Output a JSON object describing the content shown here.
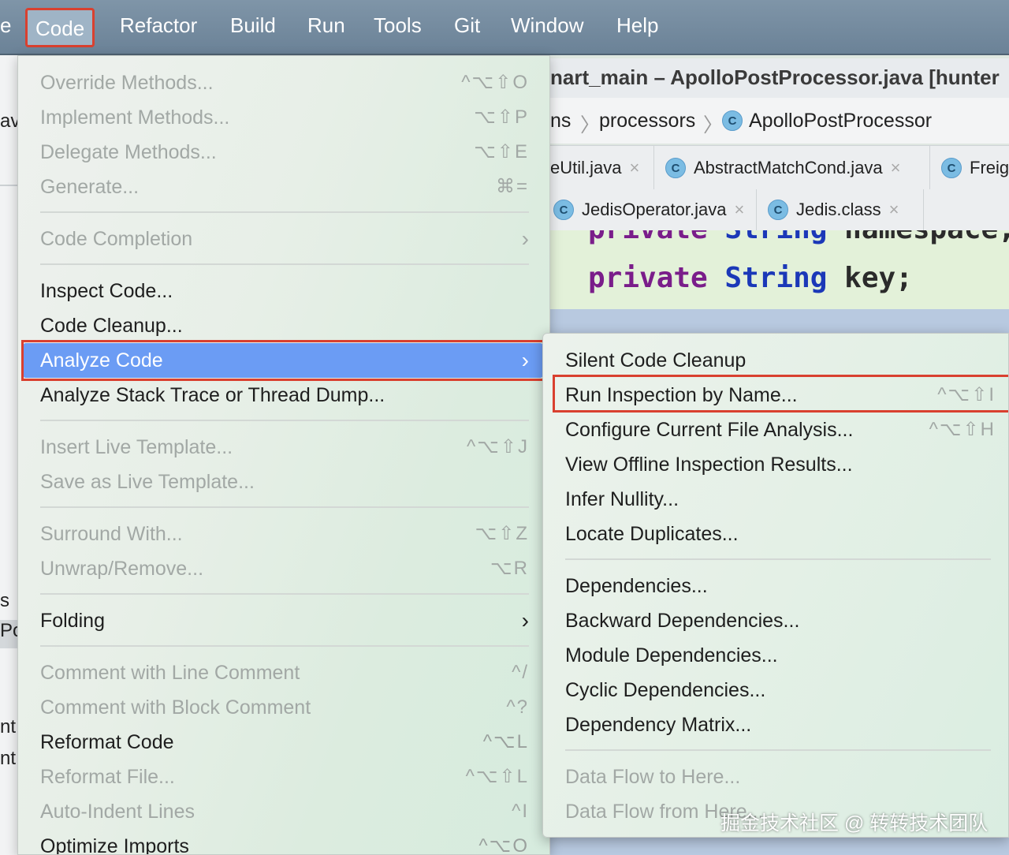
{
  "menubar": {
    "items": [
      "e",
      "Code",
      "Refactor",
      "Build",
      "Run",
      "Tools",
      "Git",
      "Window",
      "Help"
    ]
  },
  "ide": {
    "title": "nart_main – ApolloPostProcessor.java [hunter",
    "breadcrumb": [
      "ns",
      "processors",
      "ApolloPostProcessor"
    ],
    "class_badge": "C",
    "tabs_row1": [
      "eUtil.java",
      "AbstractMatchCond.java",
      "Freig"
    ],
    "tabs_row2": [
      "JedisOperator.java",
      "Jedis.class"
    ],
    "close_glyph": "×",
    "code": {
      "line1": {
        "kw": "private",
        "ty": "String",
        "id": "namespace;"
      },
      "line2": {
        "kw": "private",
        "ty": "String",
        "id": "key;"
      }
    },
    "left_strip": [
      "av",
      "s",
      "Po",
      "nt",
      "nt"
    ]
  },
  "code_menu": {
    "items": [
      {
        "label": "Override Methods...",
        "shortcut": "^⌥⇧O",
        "disabled": true
      },
      {
        "label": "Implement Methods...",
        "shortcut": "⌥⇧P",
        "disabled": true
      },
      {
        "label": "Delegate Methods...",
        "shortcut": "⌥⇧E",
        "disabled": true
      },
      {
        "label": "Generate...",
        "shortcut": "⌘=",
        "disabled": true
      },
      {
        "label": "Code Completion",
        "shortcut": "›",
        "disabled": true
      },
      {
        "label": "Inspect Code...",
        "shortcut": "",
        "disabled": false
      },
      {
        "label": "Code Cleanup...",
        "shortcut": "",
        "disabled": false
      },
      {
        "label": "Analyze Code",
        "shortcut": "›",
        "disabled": false
      },
      {
        "label": "Analyze Stack Trace or Thread Dump...",
        "shortcut": "",
        "disabled": false
      },
      {
        "label": "Insert Live Template...",
        "shortcut": "^⌥⇧J",
        "disabled": true
      },
      {
        "label": "Save as Live Template...",
        "shortcut": "",
        "disabled": true
      },
      {
        "label": "Surround With...",
        "shortcut": "⌥⇧Z",
        "disabled": true
      },
      {
        "label": "Unwrap/Remove...",
        "shortcut": "⌥R",
        "disabled": true
      },
      {
        "label": "Folding",
        "shortcut": "›",
        "disabled": false
      },
      {
        "label": "Comment with Line Comment",
        "shortcut": "^/",
        "disabled": true
      },
      {
        "label": "Comment with Block Comment",
        "shortcut": "^?",
        "disabled": true
      },
      {
        "label": "Reformat Code",
        "shortcut": "^⌥L",
        "disabled": false
      },
      {
        "label": "Reformat File...",
        "shortcut": "^⌥⇧L",
        "disabled": true
      },
      {
        "label": "Auto-Indent Lines",
        "shortcut": "^I",
        "disabled": true
      },
      {
        "label": "Optimize Imports",
        "shortcut": "^⌥O",
        "disabled": false
      }
    ]
  },
  "analyze_submenu": {
    "items": [
      {
        "label": "Silent Code Cleanup",
        "shortcut": ""
      },
      {
        "label": "Run Inspection by Name...",
        "shortcut": "^⌥⇧I"
      },
      {
        "label": "Configure Current File Analysis...",
        "shortcut": "^⌥⇧H"
      },
      {
        "label": "View Offline Inspection Results...",
        "shortcut": ""
      },
      {
        "label": "Infer Nullity...",
        "shortcut": ""
      },
      {
        "label": "Locate Duplicates...",
        "shortcut": ""
      },
      {
        "label": "Dependencies...",
        "shortcut": ""
      },
      {
        "label": "Backward Dependencies...",
        "shortcut": ""
      },
      {
        "label": "Module Dependencies...",
        "shortcut": ""
      },
      {
        "label": "Cyclic Dependencies...",
        "shortcut": ""
      },
      {
        "label": "Dependency Matrix...",
        "shortcut": ""
      },
      {
        "label": "Data Flow to Here...",
        "shortcut": ""
      },
      {
        "label": "Data Flow from Here...",
        "shortcut": ""
      }
    ]
  },
  "watermark": "掘金技术社区 @ 转转技术团队",
  "colors": {
    "highlight": "#6b9cf4",
    "annotation_red": "#d9402f",
    "menubar": "#748ba0"
  }
}
